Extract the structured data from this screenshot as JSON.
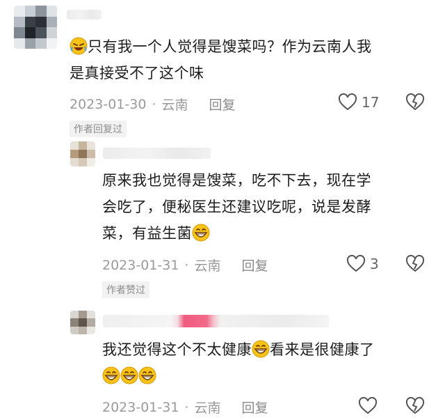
{
  "comments": [
    {
      "text_line1": "只有我一个人觉得是馊菜吗？作为云南人我",
      "text_line2": "是真接受不了这个味",
      "date": "2023-01-30",
      "location": "云南",
      "reply": "回复",
      "likes": "17",
      "badge": "作者回复过"
    },
    {
      "text_line1": "原来我也觉得是馊菜，吃不下去，现在学",
      "text_line2": "会吃了，便秘医生还建议吃呢，说是发酵",
      "text_line3": "菜，有益生菌",
      "date": "2023-01-31",
      "location": "云南",
      "reply": "回复",
      "likes": "3",
      "badge": "作者赞过"
    },
    {
      "text_line1a": "我还觉得这个不太健康",
      "text_line1b": "看来是很健康了",
      "date": "2023-01-31",
      "location": "云南",
      "reply": "回复"
    }
  ],
  "separator": "·",
  "icons": {
    "laugh_emoji": "rofl-emoji",
    "grin_emoji": "grin-emoji",
    "like": "heart-outline-icon",
    "dislike": "broken-heart-icon"
  },
  "colors": {
    "meta_text": "#9a9a9a",
    "badge_bg": "#f2f2f2",
    "emoji_yellow": "#f7c21a"
  }
}
